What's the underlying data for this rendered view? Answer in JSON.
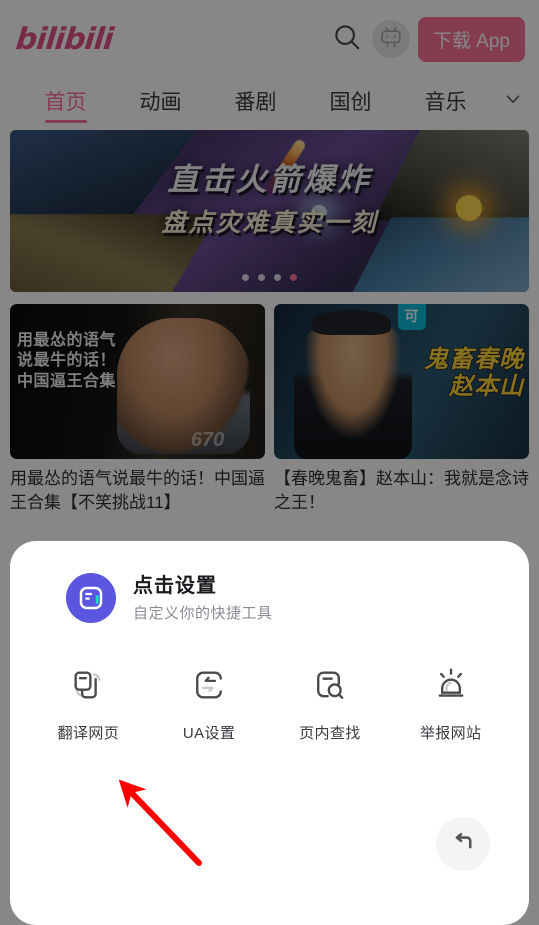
{
  "header": {
    "logo_text": "bilibili",
    "search_icon": "search-icon",
    "avatar_icon": "bilibili-tv-mascot-avatar",
    "download_app_label": "下载 App"
  },
  "nav": {
    "tabs": [
      {
        "label": "首页",
        "active": true
      },
      {
        "label": "动画",
        "active": false
      },
      {
        "label": "番剧",
        "active": false
      },
      {
        "label": "国创",
        "active": false
      },
      {
        "label": "音乐",
        "active": false
      }
    ],
    "expand_icon": "chevron-down-icon"
  },
  "banner": {
    "title": "直击火箭爆炸",
    "subtitle": "盘点灾难真实一刻",
    "dot_count": 4,
    "active_dot": 4
  },
  "feed": {
    "cards": [
      {
        "thumb_text": "用最怂的语气\n说最牛的话！\n中国逼王合集",
        "thumb_watermark": "670",
        "title": "用最怂的语气说最牛的话！中国逼王合集【不笑挑战11】"
      },
      {
        "badge": "可",
        "thumb_text_line1": "鬼畜春晚",
        "thumb_text_line2": "赵本山",
        "title": "【春晚鬼畜】赵本山：我就是念诗之王！"
      }
    ]
  },
  "sheet": {
    "logo_icon": "quark-browser-icon",
    "title": "点击设置",
    "subtitle": "自定义你的快捷工具",
    "tools": [
      {
        "label": "翻译网页",
        "icon": "translate-page-icon"
      },
      {
        "label": "UA设置",
        "icon": "ua-settings-icon"
      },
      {
        "label": "页内查找",
        "icon": "find-in-page-icon"
      },
      {
        "label": "举报网站",
        "icon": "report-site-icon"
      }
    ],
    "back_button_icon": "undo-back-icon"
  },
  "annotation": {
    "arrow_icon": "red-pointer-arrow",
    "color": "#ff0000"
  },
  "colors": {
    "brand_pink": "#fb7299",
    "sheet_accent": "#5b56e0",
    "annotation_red": "#ff0000",
    "scrim": "rgba(0,0,0,0.47)"
  }
}
